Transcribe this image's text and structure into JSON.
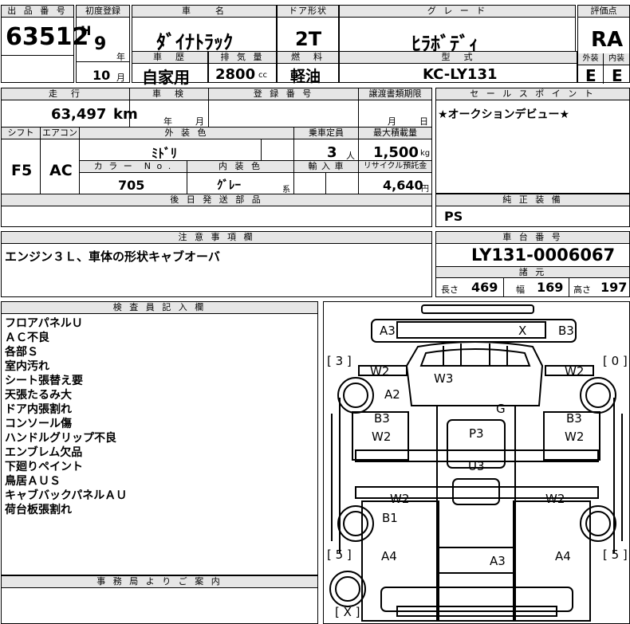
{
  "header": {
    "lot_no_label": "出 品 番 号",
    "lot_no": "63512",
    "first_reg_label": "初度登録",
    "era": "H",
    "year": "9",
    "year_unit": "年",
    "month": "10",
    "month_unit": "月",
    "car_name_label": "車　　名",
    "car_name": "ﾀﾞｲﾅﾄﾗｯｸ",
    "door_label": "ドア形状",
    "door": "2T",
    "grade_label": "グ レ ー ド",
    "grade": "ﾋﾗﾎﾞﾃﾞｨ",
    "score_label": "評価点",
    "score": "RA",
    "history_label": "車　歴",
    "history": "自家用",
    "displacement_label": "排 気 量",
    "displacement": "2800",
    "displacement_unit": "cc",
    "fuel_label": "燃　料",
    "fuel": "軽油",
    "model_label": "型　式",
    "model": "KC-LY131",
    "exterior_label": "外装",
    "exterior": "E",
    "interior_label": "内装",
    "interior": "E"
  },
  "specs": {
    "mileage_label": "走　行",
    "mileage": "63,497",
    "mileage_unit": "km",
    "inspection_label": "車　検",
    "inspection_year_unit": "年",
    "inspection_month_unit": "月",
    "reg_no_label": "登 録 番 号",
    "transfer_label": "譲渡書類期限",
    "transfer_month_unit": "月",
    "transfer_day_unit": "日",
    "shift_label": "シフト",
    "shift": "F5",
    "ac_label": "エアコン",
    "ac": "AC",
    "ext_color_label": "外 装 色",
    "ext_color": "ﾐﾄﾞﾘ",
    "capacity_label": "乗車定員",
    "capacity": "3",
    "capacity_unit": "人",
    "max_load_label": "最大積載量",
    "max_load": "1,500",
    "max_load_unit": "kg",
    "color_no_label": "カ ラ ー　N o .",
    "color_no": "705",
    "int_color_label": "内 装 色",
    "int_color": "ｸﾞﾚｰ",
    "int_color_unit": "系",
    "import_label": "輸 入 車",
    "recycle_label": "リサイクル預託金",
    "recycle": "4,640",
    "recycle_unit": "円",
    "delivery_label": "後 日 発 送 部 品"
  },
  "sales_point": {
    "label": "セ ー ル ス ポ イ ン ト",
    "text": "★オークションデビュー★"
  },
  "genuine": {
    "label": "純 正 装 備",
    "text": "PS"
  },
  "notes": {
    "label": "注 意 事 項 欄",
    "text": "エンジン３Ｌ、車体の形状キャブオーバ"
  },
  "chassis": {
    "label": "車 台 番 号",
    "number": "LY131-0006067",
    "dims_label": "諸 元",
    "length_label": "長さ",
    "length": "469",
    "width_label": "幅",
    "width": "169",
    "height_label": "高さ",
    "height": "197"
  },
  "inspector": {
    "label": "検 査 員 記 入 欄",
    "lines": [
      "フロアパネルＵ",
      "ＡＣ不良",
      "各部Ｓ",
      "室内汚れ",
      "シート張替え要",
      "天張たるみ大",
      "ドア内張割れ",
      "コンソール傷",
      "ハンドルグリップ不良",
      "エンブレム欠品",
      "下廻りペイント",
      "鳥居ＡＵＳ",
      "キャブバックパネルＡＵ",
      "荷台板張割れ"
    ]
  },
  "office": {
    "label": "事 務 局 よ り ご 案 内"
  },
  "diagram": {
    "labels": {
      "front_left": "A3",
      "front_x": "X",
      "front_right": "B3",
      "tire_fl": "[ 3 ]",
      "tire_fr": "[ 0 ]",
      "w2_left": "W2",
      "w3": "W3",
      "w2_right": "W2",
      "a2": "A2",
      "g": "G",
      "b3_left": "B3",
      "b3_right": "B3",
      "w2_left2": "W2",
      "p3": "P3",
      "w2_right2": "W2",
      "u3": "U3",
      "w2_left3": "W2",
      "w2_right3": "W2",
      "b1": "B1",
      "tire_rl": "[ 5 ]",
      "tire_rr": "[ 5 ]",
      "a4_left": "A4",
      "a3_rear": "A3",
      "a4_right": "A4",
      "spare": "[ X ]"
    }
  }
}
